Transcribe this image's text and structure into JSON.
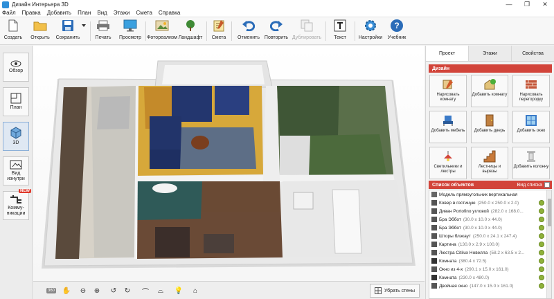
{
  "window": {
    "title": "Дизайн Интерьера 3D",
    "minimize": "—",
    "restore": "❐",
    "close": "✕"
  },
  "menu": [
    "Файл",
    "Правка",
    "Добавить",
    "План",
    "Вид",
    "Этажи",
    "Смета",
    "Справка"
  ],
  "toolbar": {
    "create": "Создать",
    "open": "Открыть",
    "save": "Сохранить",
    "print": "Печать",
    "preview": "Просмотр",
    "photoreal": "Фотореализм",
    "landscape": "Ландшафт",
    "estimate": "Смета",
    "undo": "Отменить",
    "redo": "Повторить",
    "duplicate": "Дублировать",
    "text": "Текст",
    "settings": "Настройки",
    "tutorial": "Учебник"
  },
  "left_panel": {
    "overview": "Обзор",
    "plan": "План",
    "view3d": "3D",
    "view_inside": "Вид изнутри",
    "comms": "Комму-никации",
    "new_badge": "NEW"
  },
  "bottom": {
    "remove_walls": "Убрать стены",
    "view360": "360"
  },
  "right_tabs": [
    "Проект",
    "Этажи",
    "Свойства"
  ],
  "design_section": "Дизайн",
  "design_buttons": [
    "Нарисовать комнату",
    "Добавить комнату",
    "Нарисовать перегородку",
    "Добавить мебель",
    "Добавить дверь",
    "Добавить окно",
    "Светильники и люстры",
    "Лестницы и вырезы",
    "Добавить колонну"
  ],
  "objects": {
    "title": "Список объектов",
    "view_list": "Вид списка",
    "items": [
      {
        "name": "Модель прямоугольник вертикальная",
        "dim": ""
      },
      {
        "name": "Ковер в гостиную",
        "dim": "(250.0 x 250.0 x 2.0)"
      },
      {
        "name": "Диван Portofino угловой",
        "dim": "(282.0 x 168.0..."
      },
      {
        "name": "Бра Эббот",
        "dim": "(30.0 x 10.0 x 44.0)"
      },
      {
        "name": "Бра Эббот",
        "dim": "(30.0 x 10.0 x 44.0)"
      },
      {
        "name": "Шторы блэкаут",
        "dim": "(250.0 x 24.1 x 247.4)"
      },
      {
        "name": "Картина",
        "dim": "(130.0 x 2.9 x 100.0)"
      },
      {
        "name": "Люстра Citilux Новелла",
        "dim": "(58.2 x 63.5 x 2..."
      },
      {
        "name": "Комната",
        "dim": "(380.4 x 72.5)"
      },
      {
        "name": "Окно из 4-х",
        "dim": "(290.1 x 15.0 x 161.0)"
      },
      {
        "name": "Комната",
        "dim": "(230.0 x 480.0)"
      },
      {
        "name": "Двойная окно",
        "dim": "(147.0 x 15.0 x 161.0)"
      }
    ]
  },
  "colors": {
    "accent_red": "#d2443a",
    "navy": "#23366e",
    "wood": "#8a5a3a",
    "teal": "#2f5a58",
    "grass": "#4a6a3a"
  }
}
